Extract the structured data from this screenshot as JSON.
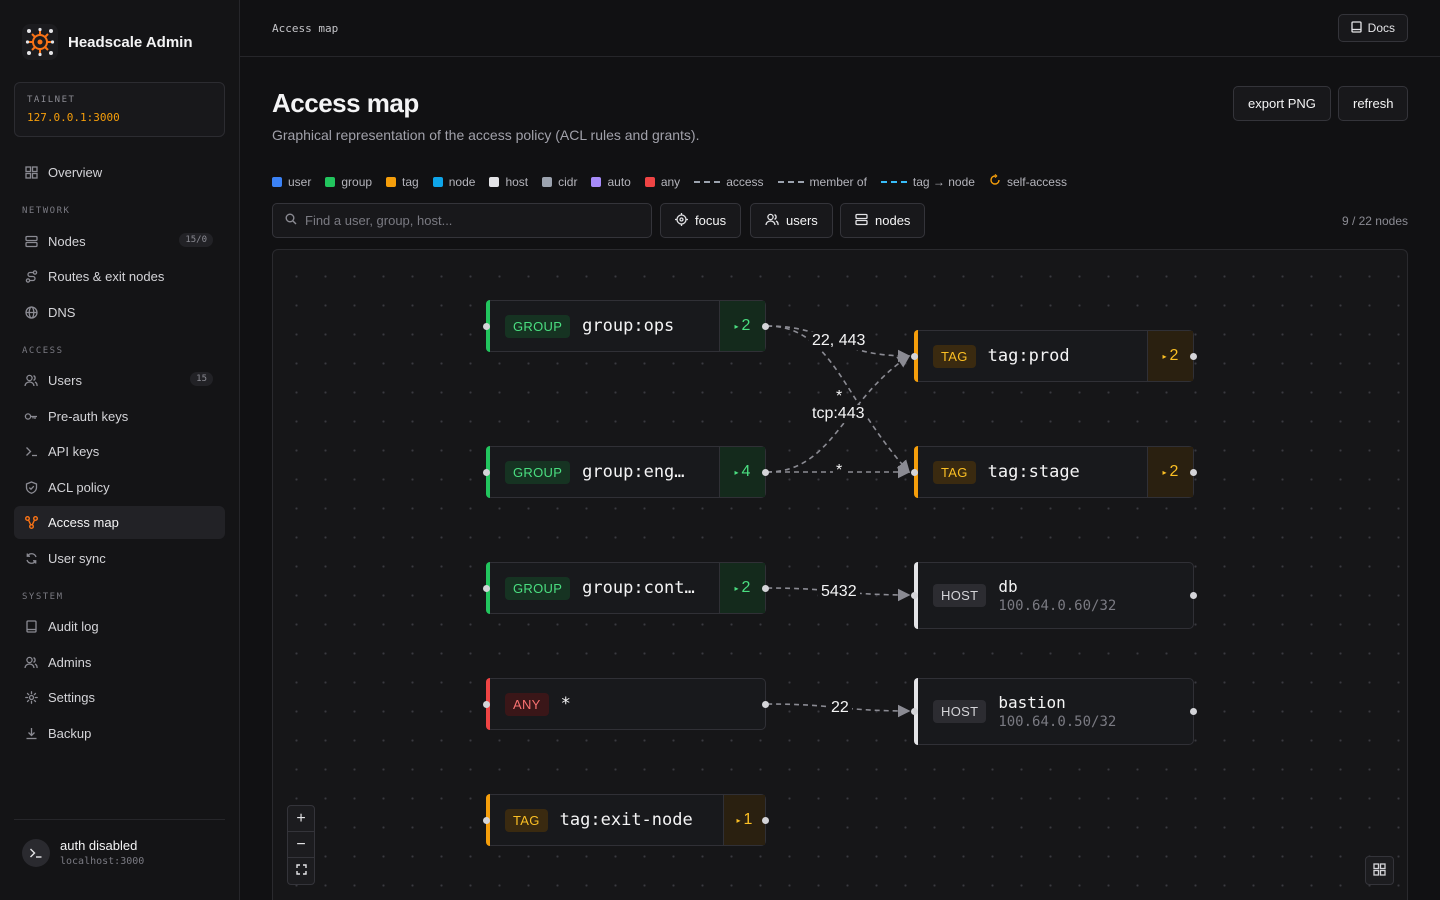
{
  "app": {
    "name": "Headscale Admin"
  },
  "tailnet": {
    "label": "TAILNET",
    "value": "127.0.0.1:3000"
  },
  "sidebar": {
    "overview": "Overview",
    "sections": {
      "network": "NETWORK",
      "access": "ACCESS",
      "system": "SYSTEM"
    },
    "network": [
      {
        "label": "Nodes",
        "badge": "15/0",
        "icon": "server-icon"
      },
      {
        "label": "Routes & exit nodes",
        "icon": "route-icon"
      },
      {
        "label": "DNS",
        "icon": "globe-icon"
      }
    ],
    "access": [
      {
        "label": "Users",
        "badge": "15",
        "icon": "user-icon"
      },
      {
        "label": "Pre-auth keys",
        "icon": "key-icon"
      },
      {
        "label": "API keys",
        "icon": "terminal-icon"
      },
      {
        "label": "ACL policy",
        "icon": "shield-icon"
      },
      {
        "label": "Access map",
        "icon": "graph-icon",
        "active": true
      },
      {
        "label": "User sync",
        "icon": "sync-icon"
      }
    ],
    "system": [
      {
        "label": "Audit log",
        "icon": "book-icon"
      },
      {
        "label": "Admins",
        "icon": "users-icon"
      },
      {
        "label": "Settings",
        "icon": "gear-icon"
      },
      {
        "label": "Backup",
        "icon": "download-icon"
      }
    ],
    "footer": {
      "title": "auth disabled",
      "subtitle": "localhost:3000"
    }
  },
  "header": {
    "breadcrumb": "Access map",
    "docs_label": "Docs"
  },
  "page": {
    "title": "Access map",
    "subtitle": "Graphical representation of the access policy (ACL rules and grants).",
    "export_label": "export PNG",
    "refresh_label": "refresh"
  },
  "legend": {
    "user": "user",
    "group": "group",
    "tag": "tag",
    "node": "node",
    "host": "host",
    "cidr": "cidr",
    "auto": "auto",
    "any": "any",
    "access": "access",
    "member_of": "member of",
    "tag_node": "tag → node",
    "self_access": "self-access",
    "colors": {
      "user": "#3b82f6",
      "group": "#22c55e",
      "tag": "#f59e0b",
      "node": "#0ea5e9",
      "host": "#e4e4e7",
      "cidr": "#9ca3af",
      "auto": "#a78bfa",
      "any": "#ef4444"
    }
  },
  "toolbar": {
    "search_placeholder": "Find a user, group, host...",
    "focus_label": "focus",
    "users_label": "users",
    "nodes_label": "nodes",
    "node_count": "9 / 22 nodes"
  },
  "graph": {
    "sources": [
      {
        "kind": "GROUP",
        "label": "group:ops",
        "count": "2"
      },
      {
        "kind": "GROUP",
        "label": "group:eng…",
        "count": "4"
      },
      {
        "kind": "GROUP",
        "label": "group:cont…",
        "count": "2"
      },
      {
        "kind": "ANY",
        "label": "*"
      },
      {
        "kind": "TAG",
        "label": "tag:exit-node",
        "count": "1"
      }
    ],
    "targets": [
      {
        "kind": "TAG",
        "label": "tag:prod",
        "count": "2"
      },
      {
        "kind": "TAG",
        "label": "tag:stage",
        "count": "2"
      },
      {
        "kind": "HOST",
        "label": "db",
        "ip": "100.64.0.60/32"
      },
      {
        "kind": "HOST",
        "label": "bastion",
        "ip": "100.64.0.50/32"
      }
    ],
    "edges": {
      "ops_prod": "22, 443",
      "star_a": "*",
      "eng_tcp": "tcp:443",
      "eng_stage": "*",
      "cont_db": "5432",
      "any_bastion": "22"
    }
  },
  "zoom": {
    "in": "+",
    "out": "−"
  }
}
